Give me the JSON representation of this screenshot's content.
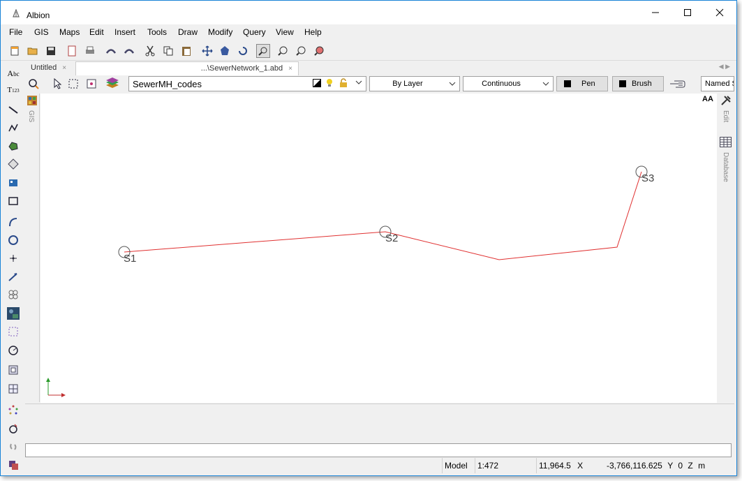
{
  "window": {
    "title": "Albion"
  },
  "menu": [
    "File",
    "GIS",
    "Maps",
    "Edit",
    "Insert",
    "Tools",
    "Draw",
    "Modify",
    "Query",
    "View",
    "Help"
  ],
  "tabs": [
    {
      "label": "Untitled",
      "close": "×"
    },
    {
      "label": "...\\SewerNetwork_1.abd",
      "close": "×"
    }
  ],
  "layerbar": {
    "layer_name": "SewerMH_codes",
    "color_mode": "By Layer",
    "linetype": "Continuous",
    "pen_label": "Pen",
    "brush_label": "Brush",
    "named_label": "Named S"
  },
  "canvas": {
    "labels": [
      "S1",
      "S2",
      "S3"
    ],
    "line_color": "#e03030"
  },
  "side_panels": {
    "gis": "GIS",
    "edit": "Edit",
    "database": "Database",
    "aa": "AA"
  },
  "status": {
    "mode": "Model",
    "scale": "1:472",
    "x": "11,964.5",
    "x_label": "X",
    "y": "-3,766,116.625",
    "y_label": "Y",
    "z": "0",
    "z_label": "Z",
    "unit": "m"
  },
  "colors": {
    "accent": "#1883d7"
  }
}
